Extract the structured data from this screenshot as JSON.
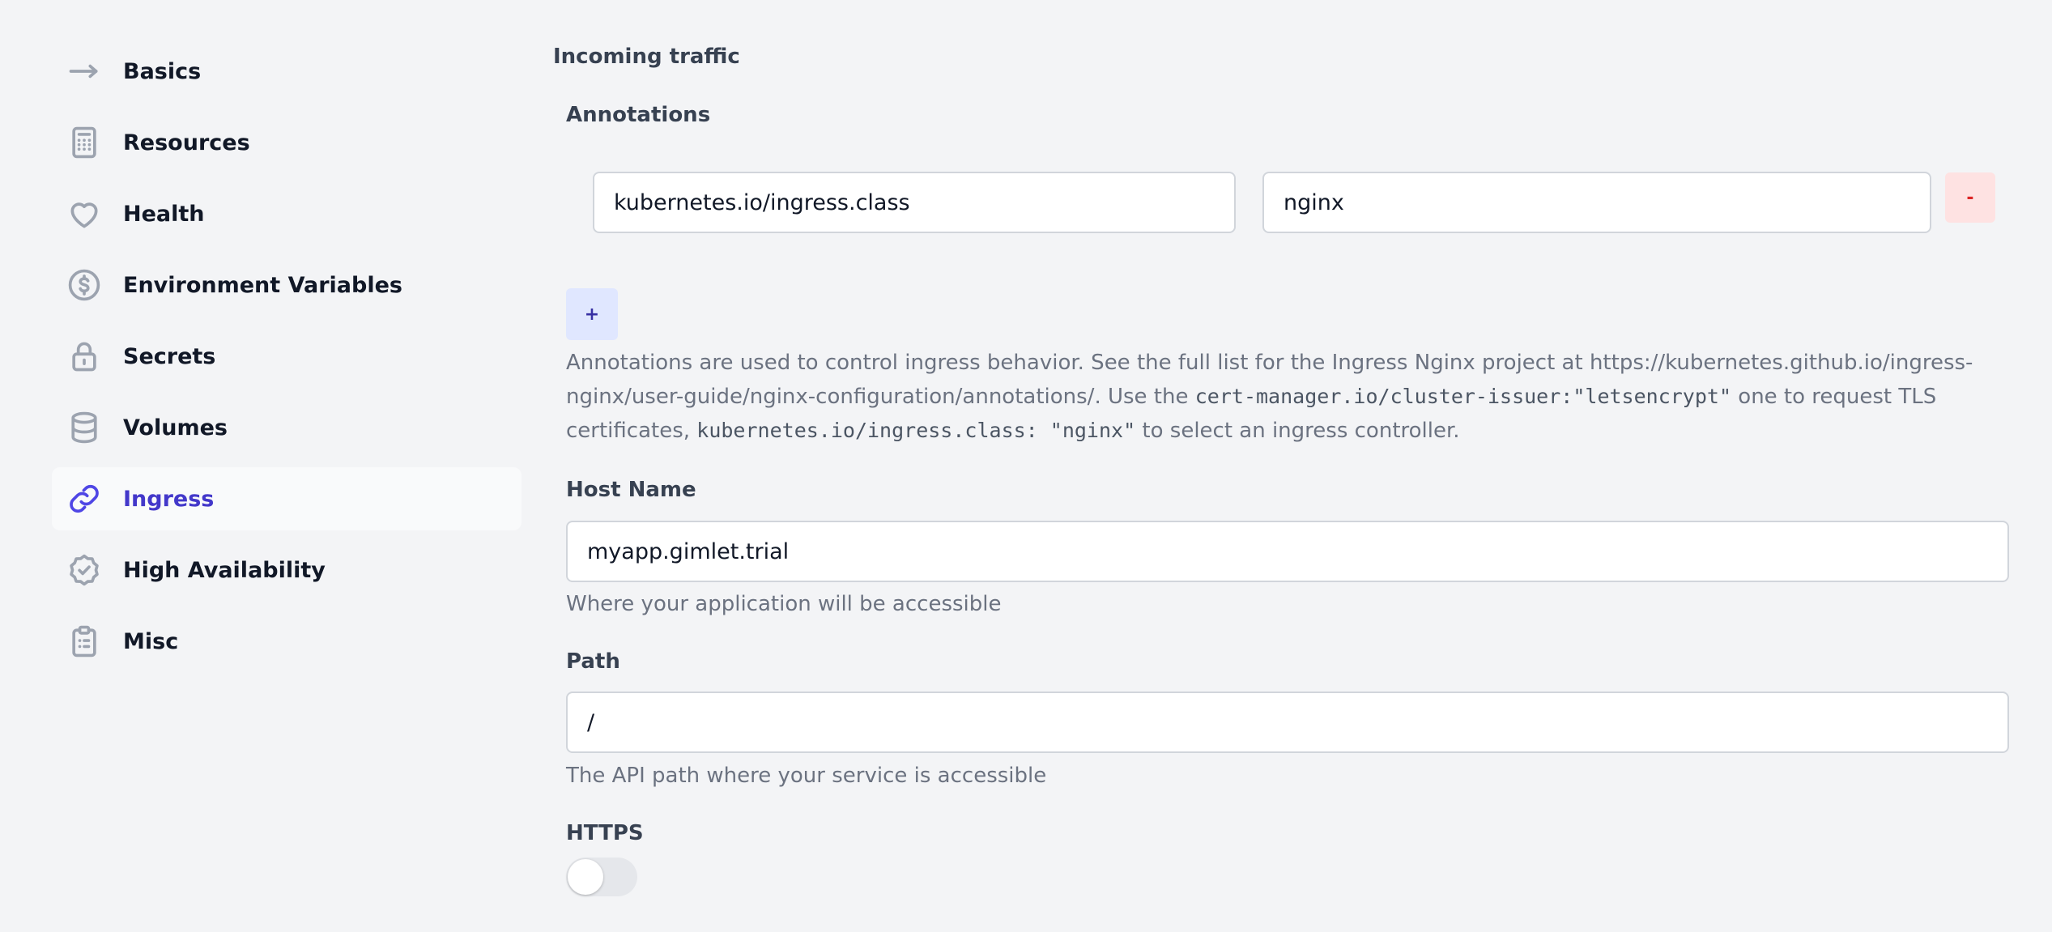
{
  "sidebar": {
    "items": [
      {
        "label": "Basics",
        "icon": "arrow-right-icon",
        "active": false
      },
      {
        "label": "Resources",
        "icon": "calculator-icon",
        "active": false
      },
      {
        "label": "Health",
        "icon": "heart-icon",
        "active": false
      },
      {
        "label": "Environment Variables",
        "icon": "currency-dollar-icon",
        "active": false
      },
      {
        "label": "Secrets",
        "icon": "lock-icon",
        "active": false
      },
      {
        "label": "Volumes",
        "icon": "database-icon",
        "active": false
      },
      {
        "label": "Ingress",
        "icon": "link-icon",
        "active": true
      },
      {
        "label": "High Availability",
        "icon": "badge-check-icon",
        "active": false
      },
      {
        "label": "Misc",
        "icon": "clipboard-list-icon",
        "active": false
      }
    ]
  },
  "main": {
    "section_title": "Incoming traffic",
    "annotations": {
      "title": "Annotations",
      "rows": [
        {
          "key": "kubernetes.io/ingress.class",
          "value": "nginx"
        }
      ],
      "remove_label": "-",
      "add_label": "+",
      "help_part1": "Annotations are used to control ingress behavior. See the full list for the Ingress Nginx project at https://kubernetes.github.io/ingress-nginx/user-guide/nginx-configuration/annotations/. Use the ",
      "help_code1": "cert-manager.io/cluster-issuer:\"letsencrypt\"",
      "help_part2": " one to request TLS certificates, ",
      "help_code2": "kubernetes.io/ingress.class: \"nginx\"",
      "help_part3": " to select an ingress controller."
    },
    "host": {
      "title": "Host Name",
      "value": "myapp.gimlet.trial",
      "help": "Where your application will be accessible"
    },
    "path": {
      "title": "Path",
      "value": "/",
      "help": "The API path where your service is accessible"
    },
    "https": {
      "title": "HTTPS",
      "enabled": false
    }
  },
  "colors": {
    "background": "#f3f4f6",
    "accent": "#4f46e5",
    "danger_bg": "#fee2e2",
    "add_bg": "#e0e7ff"
  }
}
